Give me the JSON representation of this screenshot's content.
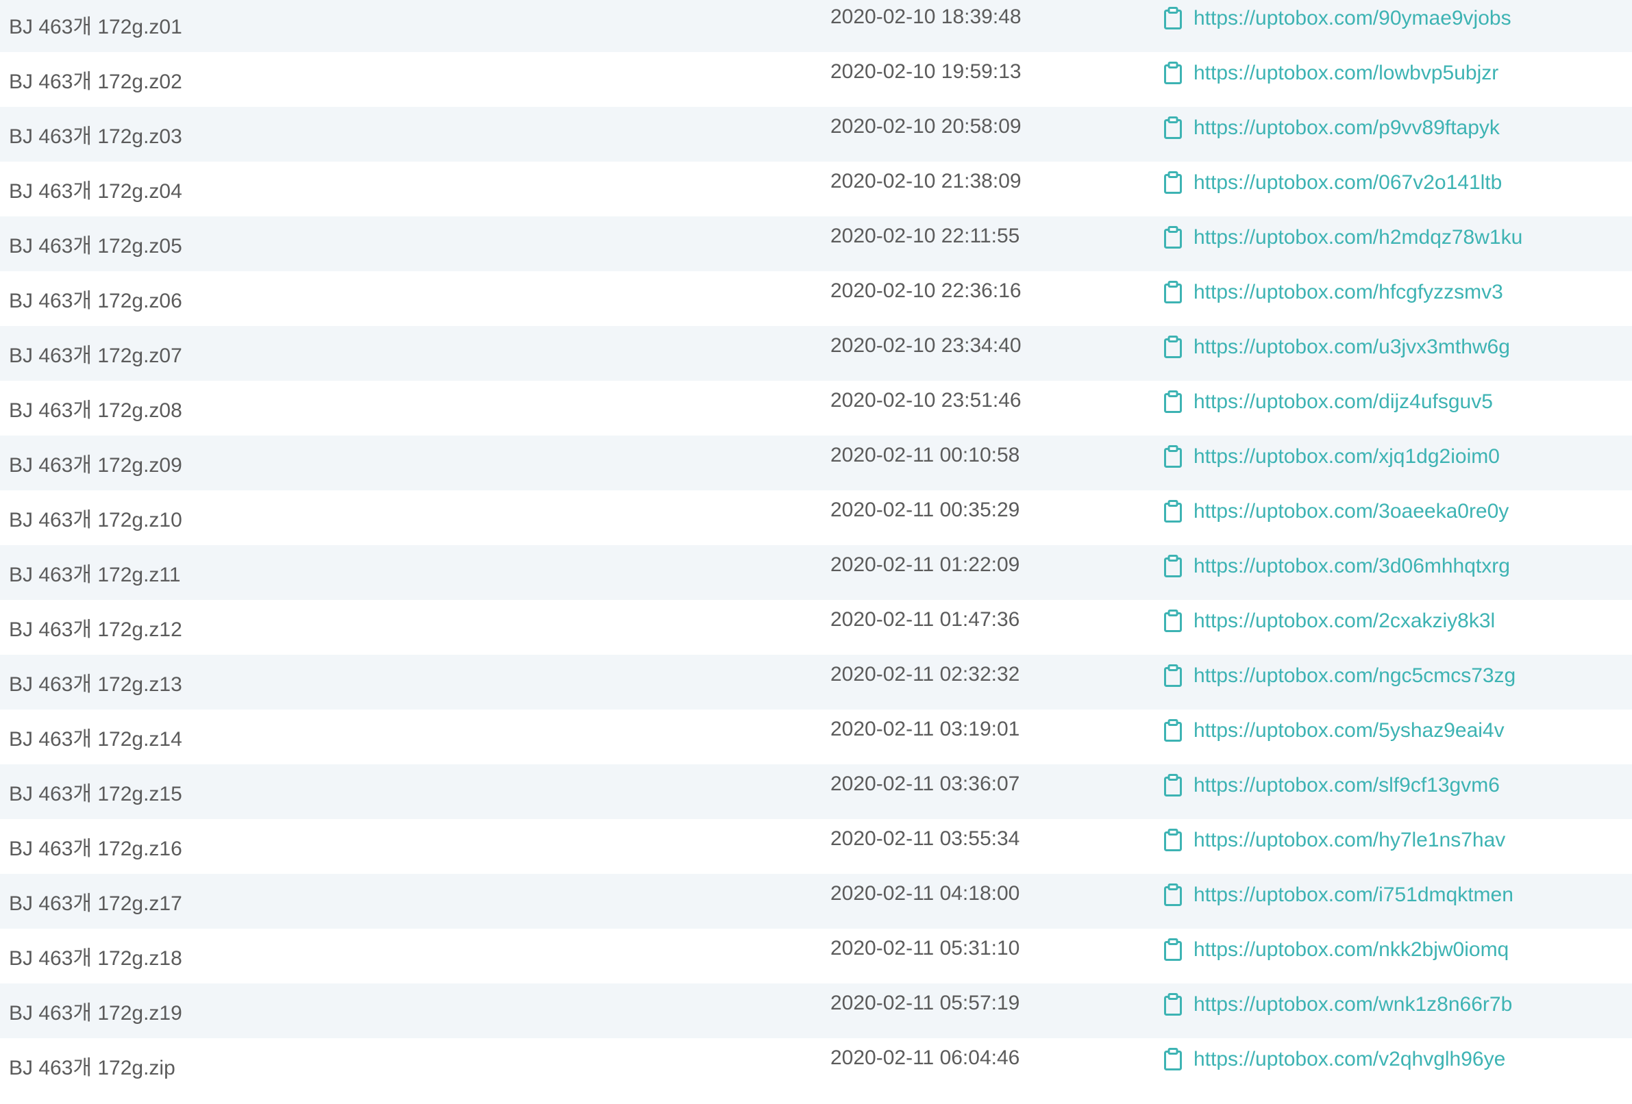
{
  "colors": {
    "text": "#5b5b5b",
    "link": "#3db3b3",
    "row_stripe": "#f2f6f9",
    "row_plain": "#ffffff"
  },
  "link_icon": "clipboard-icon",
  "rows": [
    {
      "name": "BJ 463개 172g.z01",
      "date": "2020-02-10 18:39:48",
      "url": "https://uptobox.com/90ymae9vjobs"
    },
    {
      "name": "BJ 463개 172g.z02",
      "date": "2020-02-10 19:59:13",
      "url": "https://uptobox.com/lowbvp5ubjzr"
    },
    {
      "name": "BJ 463개 172g.z03",
      "date": "2020-02-10 20:58:09",
      "url": "https://uptobox.com/p9vv89ftapyk"
    },
    {
      "name": "BJ 463개 172g.z04",
      "date": "2020-02-10 21:38:09",
      "url": "https://uptobox.com/067v2o141ltb"
    },
    {
      "name": "BJ 463개 172g.z05",
      "date": "2020-02-10 22:11:55",
      "url": "https://uptobox.com/h2mdqz78w1ku"
    },
    {
      "name": "BJ 463개 172g.z06",
      "date": "2020-02-10 22:36:16",
      "url": "https://uptobox.com/hfcgfyzzsmv3"
    },
    {
      "name": "BJ 463개 172g.z07",
      "date": "2020-02-10 23:34:40",
      "url": "https://uptobox.com/u3jvx3mthw6g"
    },
    {
      "name": "BJ 463개 172g.z08",
      "date": "2020-02-10 23:51:46",
      "url": "https://uptobox.com/dijz4ufsguv5"
    },
    {
      "name": "BJ 463개 172g.z09",
      "date": "2020-02-11 00:10:58",
      "url": "https://uptobox.com/xjq1dg2ioim0"
    },
    {
      "name": "BJ 463개 172g.z10",
      "date": "2020-02-11 00:35:29",
      "url": "https://uptobox.com/3oaeeka0re0y"
    },
    {
      "name": "BJ 463개 172g.z11",
      "date": "2020-02-11 01:22:09",
      "url": "https://uptobox.com/3d06mhhqtxrg"
    },
    {
      "name": "BJ 463개 172g.z12",
      "date": "2020-02-11 01:47:36",
      "url": "https://uptobox.com/2cxakziy8k3l"
    },
    {
      "name": "BJ 463개 172g.z13",
      "date": "2020-02-11 02:32:32",
      "url": "https://uptobox.com/ngc5cmcs73zg"
    },
    {
      "name": "BJ 463개 172g.z14",
      "date": "2020-02-11 03:19:01",
      "url": "https://uptobox.com/5yshaz9eai4v"
    },
    {
      "name": "BJ 463개 172g.z15",
      "date": "2020-02-11 03:36:07",
      "url": "https://uptobox.com/slf9cf13gvm6"
    },
    {
      "name": "BJ 463개 172g.z16",
      "date": "2020-02-11 03:55:34",
      "url": "https://uptobox.com/hy7le1ns7hav"
    },
    {
      "name": "BJ 463개 172g.z17",
      "date": "2020-02-11 04:18:00",
      "url": "https://uptobox.com/i751dmqktmen"
    },
    {
      "name": "BJ 463개 172g.z18",
      "date": "2020-02-11 05:31:10",
      "url": "https://uptobox.com/nkk2bjw0iomq"
    },
    {
      "name": "BJ 463개 172g.z19",
      "date": "2020-02-11 05:57:19",
      "url": "https://uptobox.com/wnk1z8n66r7b"
    },
    {
      "name": "BJ 463개 172g.zip",
      "date": "2020-02-11 06:04:46",
      "url": "https://uptobox.com/v2qhvglh96ye"
    }
  ]
}
